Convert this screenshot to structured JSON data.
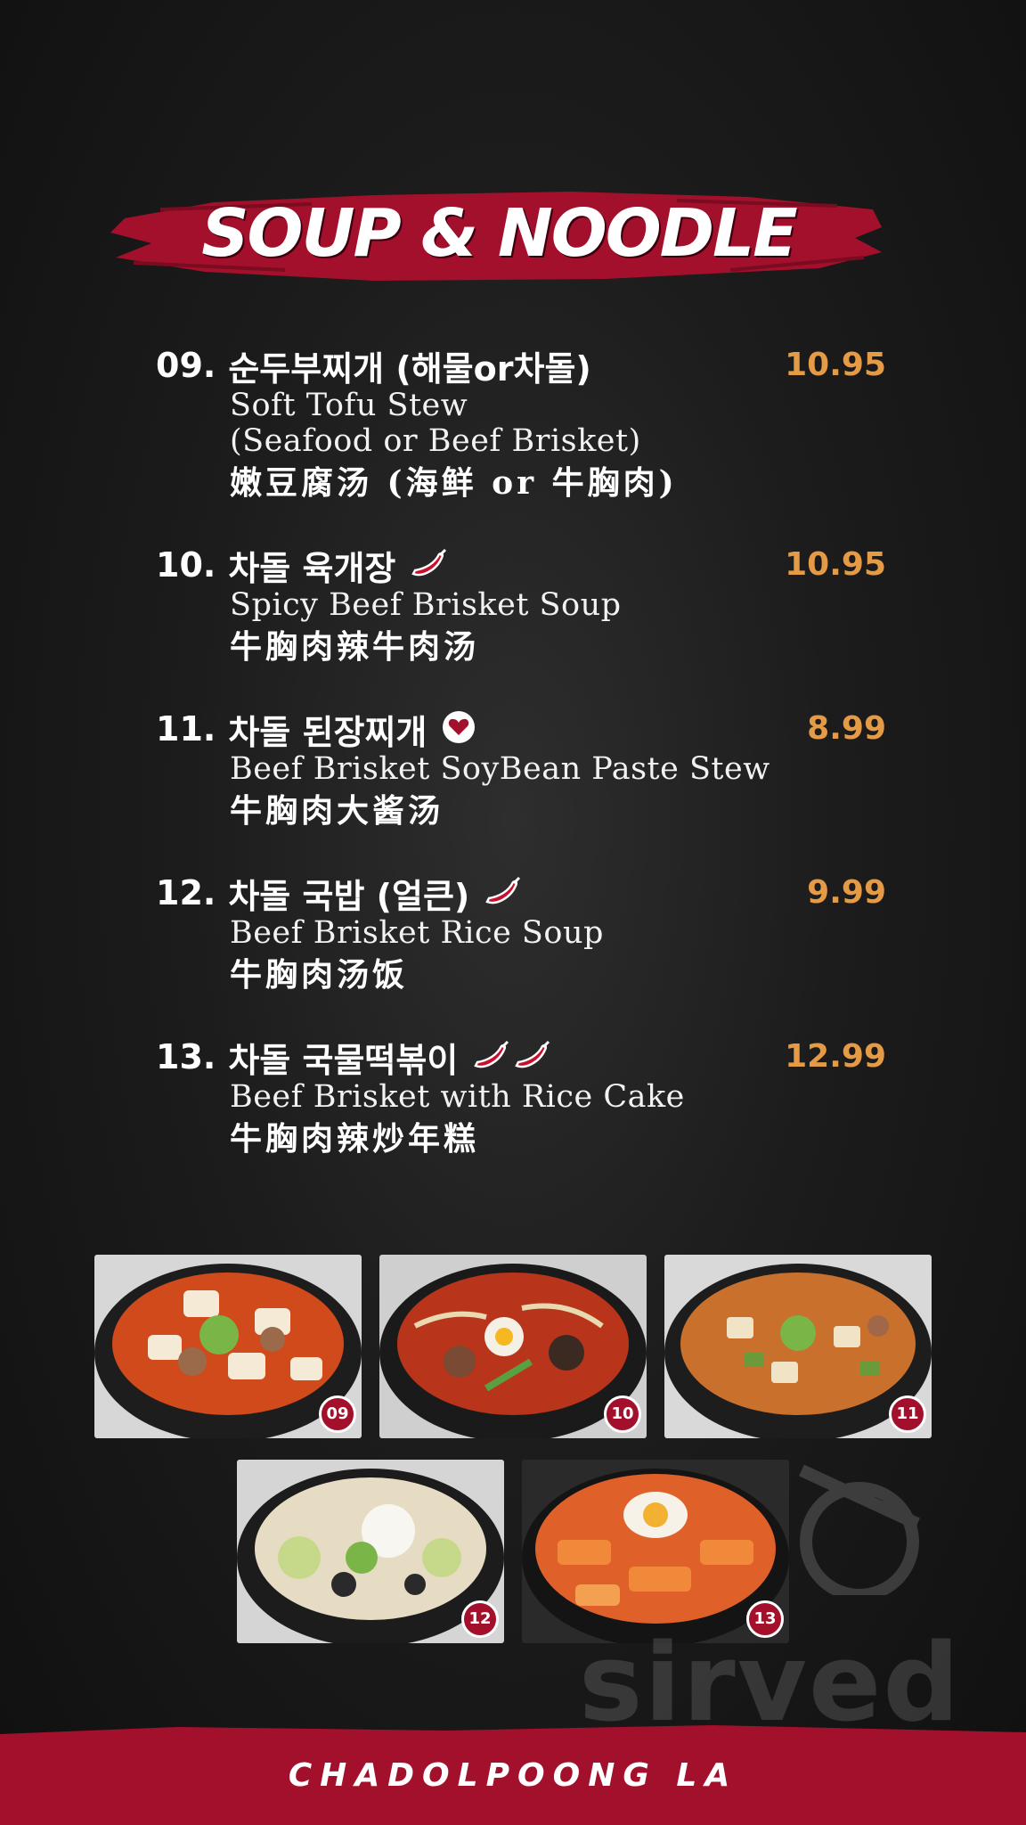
{
  "header": {
    "title": "SOUP & NOODLE"
  },
  "colors": {
    "brand_red": "#a3102c",
    "price_orange": "#e59a45",
    "background": "#1c1c1c"
  },
  "menu": {
    "items": [
      {
        "number": "09.",
        "korean": "순두부찌개 (해물or차돌)",
        "english": [
          "Soft Tofu Stew",
          "(Seafood or Beef Brisket)"
        ],
        "chinese": "嫩豆腐汤 (海鲜 or 牛胸肉)",
        "price": "10.95",
        "icons": []
      },
      {
        "number": "10.",
        "korean": "차돌 육개장",
        "english": [
          "Spicy Beef Brisket Soup"
        ],
        "chinese": "牛胸肉辣牛肉汤",
        "price": "10.95",
        "icons": [
          "chili-pepper-icon"
        ]
      },
      {
        "number": "11.",
        "korean": "차돌 된장찌개",
        "english": [
          "Beef Brisket SoyBean Paste Stew"
        ],
        "chinese": "牛胸肉大酱汤",
        "price": "8.99",
        "icons": [
          "heart-icon"
        ]
      },
      {
        "number": "12.",
        "korean": "차돌 국밥 (얼큰)",
        "english": [
          "Beef Brisket Rice Soup"
        ],
        "chinese": "牛胸肉汤饭",
        "price": "9.99",
        "icons": [
          "chili-pepper-icon"
        ]
      },
      {
        "number": "13.",
        "korean": "차돌 국물떡볶이",
        "english": [
          "Beef Brisket with Rice Cake"
        ],
        "chinese": "牛胸肉辣炒年糕",
        "price": "12.99",
        "icons": [
          "chili-pepper-icon",
          "chili-pepper-icon"
        ]
      }
    ]
  },
  "photos": [
    {
      "badge": "09"
    },
    {
      "badge": "10"
    },
    {
      "badge": "11"
    },
    {
      "badge": "12"
    },
    {
      "badge": "13"
    }
  ],
  "watermark": {
    "text": "sirved"
  },
  "footer": {
    "text": "CHADOLPOONG LA"
  }
}
